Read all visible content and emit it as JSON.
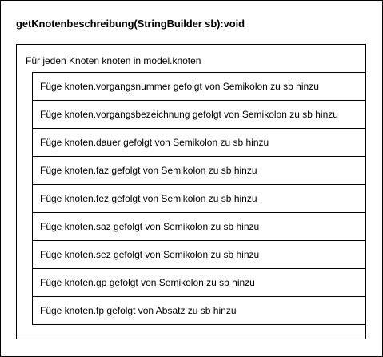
{
  "title": "getKnotenbeschreibung(StringBuilder sb):void",
  "loop": {
    "header": "Für jeden Knoten knoten in model.knoten",
    "statements": [
      "Füge knoten.vorgangsnummer gefolgt von Semikolon zu sb hinzu",
      "Füge knoten.vorgangsbezeichnung gefolgt von Semikolon zu sb hinzu",
      "Füge knoten.dauer gefolgt von Semikolon zu sb hinzu",
      "Füge knoten.faz gefolgt von Semikolon zu sb hinzu",
      "Füge knoten.fez gefolgt von Semikolon zu sb hinzu",
      "Füge knoten.saz gefolgt von Semikolon zu sb hinzu",
      "Füge knoten.sez gefolgt von Semikolon zu sb hinzu",
      "Füge knoten.gp gefolgt von Semikolon zu sb hinzu",
      "Füge knoten.fp gefolgt von Absatz zu sb hinzu"
    ]
  }
}
